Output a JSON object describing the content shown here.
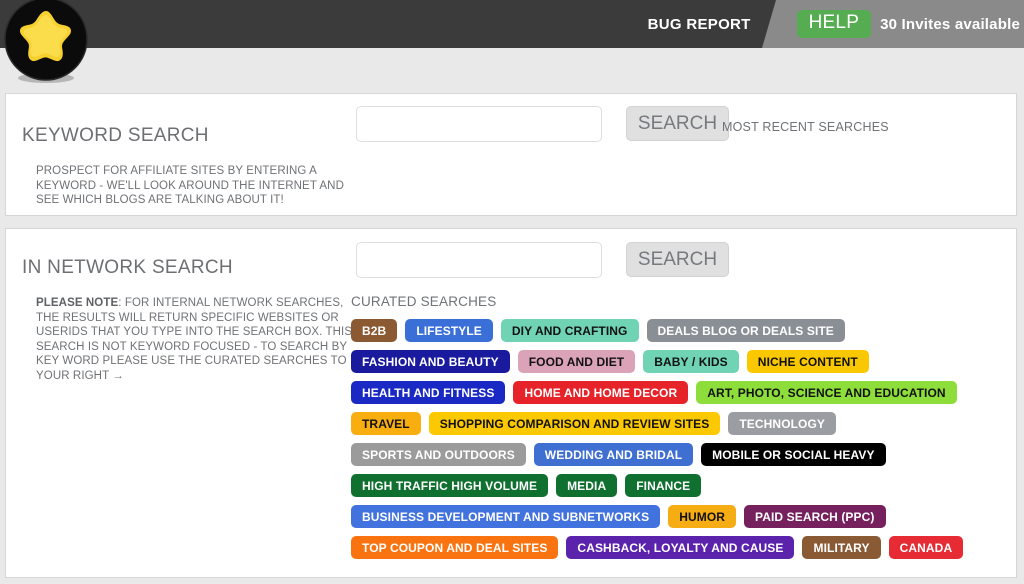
{
  "header": {
    "bug_report_label": "BUG REPORT",
    "help_label": "HELP",
    "invites_label": "30 Invites available",
    "logo_icon": "star-badge-icon",
    "bar_color": "#3b3b3b",
    "angle_color": "#8a8a8a",
    "help_color": "#56ad51"
  },
  "keyword_section": {
    "title": "KEYWORD SEARCH",
    "blurb": "PROSPECT FOR AFFILIATE SITES BY ENTERING A KEYWORD - WE'LL LOOK AROUND THE INTERNET AND SEE WHICH BLOGS ARE TALKING ABOUT IT!",
    "input_value": "",
    "input_placeholder": "",
    "search_label": "SEARCH",
    "recent_searches_label": "MOST RECENT SEARCHES"
  },
  "network_section": {
    "title": "IN NETWORK SEARCH",
    "note_lead": "PLEASE NOTE",
    "note_body": ": FOR INTERNAL NETWORK SEARCHES, THE RESULTS WILL RETURN SPECIFIC WEBSITES OR USERIDS THAT YOU TYPE INTO THE SEARCH BOX. THIS SEARCH IS NOT KEYWORD FOCUSED - TO SEARCH BY KEY WORD PLEASE USE THE CURATED SEARCHES TO YOUR RIGHT →",
    "input_value": "",
    "input_placeholder": "",
    "search_label": "SEARCH",
    "curated_label": "CURATED SEARCHES"
  },
  "curated_tags": [
    [
      {
        "label": "B2B",
        "bg": "#8c5a32",
        "fg": "#ffffff"
      },
      {
        "label": "LIFESTYLE",
        "bg": "#3a6fd8",
        "fg": "#ffffff"
      },
      {
        "label": "DIY AND CRAFTING",
        "bg": "#6fd3b4",
        "fg": "#111111"
      },
      {
        "label": "DEALS BLOG OR DEALS SITE",
        "bg": "#8a8f96",
        "fg": "#ffffff"
      }
    ],
    [
      {
        "label": "FASHION AND BEAUTY",
        "bg": "#1a1a9e",
        "fg": "#ffffff"
      },
      {
        "label": "FOOD AND DIET",
        "bg": "#dba3b8",
        "fg": "#111111"
      },
      {
        "label": "BABY / KIDS",
        "bg": "#6fd3b4",
        "fg": "#111111"
      },
      {
        "label": "NICHE CONTENT",
        "bg": "#f9c800",
        "fg": "#111111"
      }
    ],
    [
      {
        "label": "HEALTH AND FITNESS",
        "bg": "#1a29c4",
        "fg": "#ffffff"
      },
      {
        "label": "HOME AND HOME DECOR",
        "bg": "#e62328",
        "fg": "#ffffff"
      },
      {
        "label": "ART, PHOTO, SCIENCE AND EDUCATION",
        "bg": "#8ede3b",
        "fg": "#111111"
      }
    ],
    [
      {
        "label": "TRAVEL",
        "bg": "#f9ae10",
        "fg": "#111111"
      },
      {
        "label": "SHOPPING COMPARISON AND REVIEW SITES",
        "bg": "#fcc900",
        "fg": "#111111"
      },
      {
        "label": "TECHNOLOGY",
        "bg": "#9a9ea3",
        "fg": "#ffffff"
      }
    ],
    [
      {
        "label": "SPORTS AND OUTDOORS",
        "bg": "#9b9b9b",
        "fg": "#ffffff"
      },
      {
        "label": "WEDDING AND BRIDAL",
        "bg": "#3f6fd0",
        "fg": "#ffffff"
      },
      {
        "label": "MOBILE OR SOCIAL HEAVY",
        "bg": "#000000",
        "fg": "#ffffff"
      }
    ],
    [
      {
        "label": "HIGH TRAFFIC HIGH VOLUME",
        "bg": "#107030",
        "fg": "#ffffff"
      },
      {
        "label": "MEDIA",
        "bg": "#107030",
        "fg": "#ffffff"
      },
      {
        "label": "FINANCE",
        "bg": "#107030",
        "fg": "#ffffff"
      }
    ],
    [
      {
        "label": "BUSINESS DEVELOPMENT AND SUBNETWORKS",
        "bg": "#4272de",
        "fg": "#ffffff"
      },
      {
        "label": "HUMOR",
        "bg": "#f6ac13",
        "fg": "#111111"
      },
      {
        "label": "PAID SEARCH (PPC)",
        "bg": "#76215e",
        "fg": "#ffffff"
      }
    ],
    [
      {
        "label": "TOP COUPON AND DEAL SITES",
        "bg": "#f97410",
        "fg": "#ffffff"
      },
      {
        "label": "CASHBACK, LOYALTY AND CAUSE",
        "bg": "#5b22ac",
        "fg": "#ffffff"
      },
      {
        "label": "MILITARY",
        "bg": "#8a5a34",
        "fg": "#ffffff"
      },
      {
        "label": "CANADA",
        "bg": "#e62b34",
        "fg": "#ffffff"
      }
    ]
  ]
}
